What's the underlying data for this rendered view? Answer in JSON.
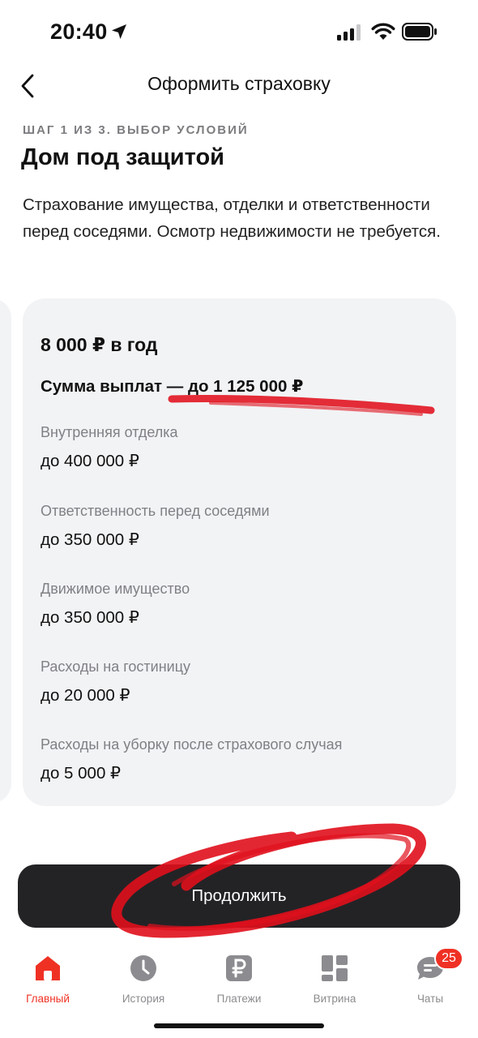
{
  "status_bar": {
    "time": "20:40"
  },
  "header": {
    "title": "Оформить страховку"
  },
  "step_label": "ШАГ 1 ИЗ 3. ВЫБОР УСЛОВИЙ",
  "page_title": "Дом под защитой",
  "description": "Страхование имущества, отделки и ответственности перед соседями. Осмотр недвижимости не требуется.",
  "card": {
    "price": "8 000 ₽ в год",
    "total": "Сумма выплат — до 1 125 000 ₽",
    "coverages": [
      {
        "label": "Внутренняя отделка",
        "value": "до 400 000 ₽"
      },
      {
        "label": "Ответственность перед соседями",
        "value": "до 350 000 ₽"
      },
      {
        "label": "Движимое имущество",
        "value": "до 350 000 ₽"
      },
      {
        "label": "Расходы на гостиницу",
        "value": "до 20 000 ₽"
      },
      {
        "label": "Расходы на уборку после страхового случая",
        "value": "до 5 000 ₽"
      }
    ]
  },
  "continue_button": {
    "label": "Продолжить"
  },
  "tabs": [
    {
      "label": "Главный",
      "icon": "home-icon",
      "active": true
    },
    {
      "label": "История",
      "icon": "clock-icon"
    },
    {
      "label": "Платежи",
      "icon": "ruble-icon"
    },
    {
      "label": "Витрина",
      "icon": "grid-icon"
    },
    {
      "label": "Чаты",
      "icon": "chat-icon",
      "badge": "25"
    }
  ],
  "colors": {
    "accent": "#ef3124",
    "button": "#232326",
    "card": "#f2f3f5",
    "muted": "#808085"
  }
}
